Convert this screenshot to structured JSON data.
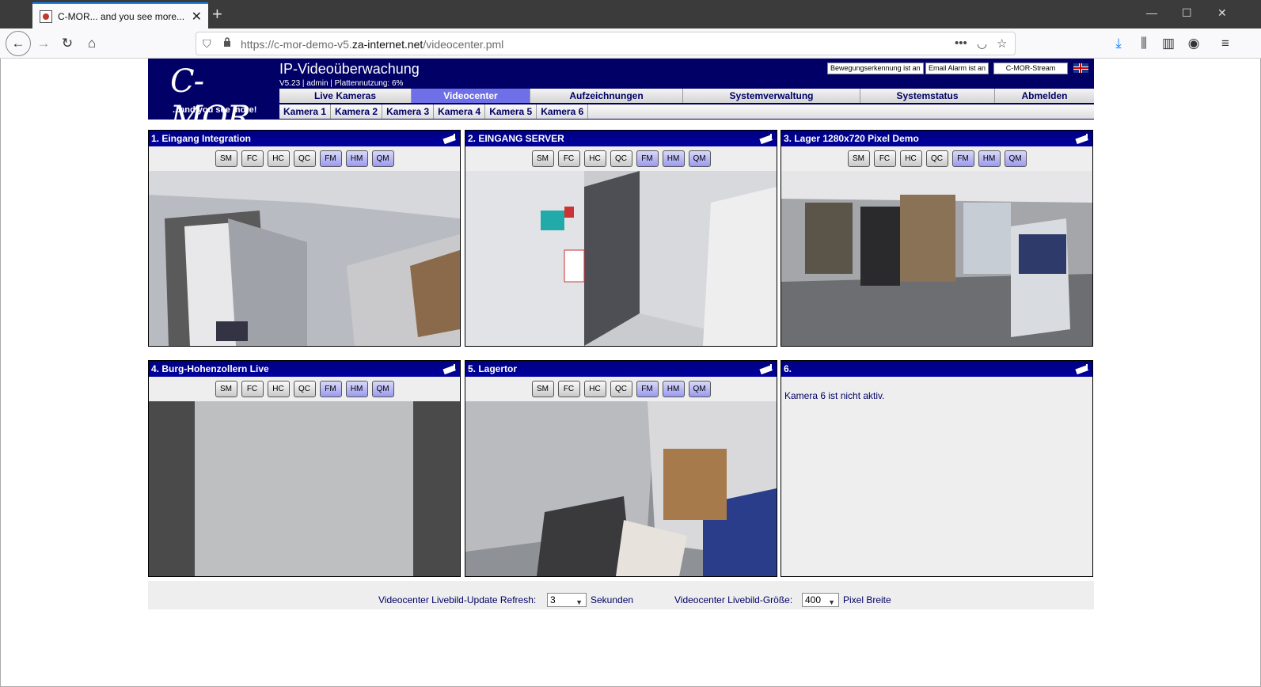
{
  "browser": {
    "tab_title": "C-MOR... and you see more...",
    "url_prefix": "https://c-mor-demo-v5.",
    "url_host": "za-internet.net",
    "url_path": "/videocenter.pml"
  },
  "header": {
    "logo_text": "C-MOR",
    "logo_tagline": "...and you see more!",
    "title": "IP-Videoüberwachung",
    "subtitle": "V5.23 | admin | Plattennutzung: 6%",
    "status_buttons": [
      "Bewegungserkennung ist an",
      "Email Alarm ist an",
      "C-MOR-Stream"
    ]
  },
  "main_nav": [
    {
      "label": "Live Kameras",
      "active": false
    },
    {
      "label": "Videocenter",
      "active": true
    },
    {
      "label": "Aufzeichnungen",
      "active": false
    },
    {
      "label": "Systemverwaltung",
      "active": false
    },
    {
      "label": "Systemstatus",
      "active": false
    },
    {
      "label": "Abmelden",
      "active": false
    }
  ],
  "camera_tabs": [
    "Kamera 1",
    "Kamera 2",
    "Kamera 3",
    "Kamera 4",
    "Kamera 5",
    "Kamera 6"
  ],
  "mode_buttons": [
    "SM",
    "FC",
    "HC",
    "QC",
    "FM",
    "HM",
    "QM"
  ],
  "cameras": [
    {
      "title": "1. Eingang Integration",
      "active": true
    },
    {
      "title": "2. EINGANG SERVER",
      "active": true
    },
    {
      "title": "3. Lager 1280x720 Pixel Demo",
      "active": true
    },
    {
      "title": "4. Burg-Hohenzollern Live",
      "active": true
    },
    {
      "title": "5. Lagertor",
      "active": true
    },
    {
      "title": "6.",
      "active": false,
      "message": "Kamera 6 ist nicht aktiv."
    }
  ],
  "footer": {
    "refresh_label": "Videocenter Livebild-Update Refresh:",
    "refresh_value": "3",
    "refresh_unit": "Sekunden",
    "size_label": "Videocenter Livebild-Größe:",
    "size_value": "400",
    "size_unit": "Pixel Breite"
  }
}
